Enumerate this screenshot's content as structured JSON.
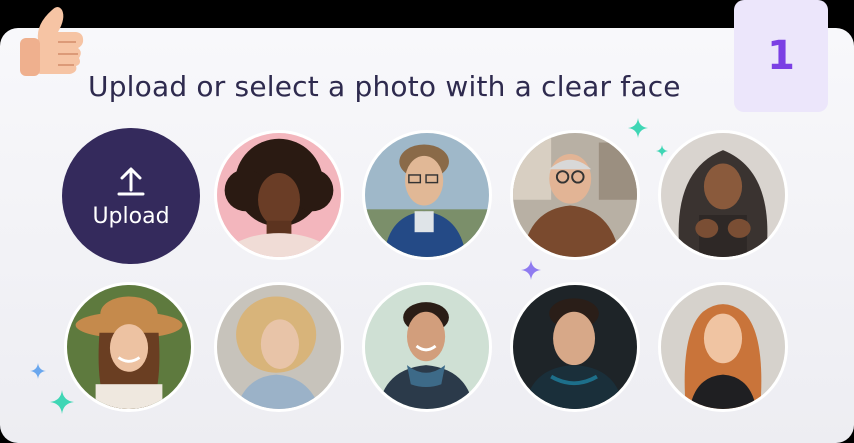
{
  "header": {
    "title": "Upload or select a photo with a clear face",
    "step_number": "1"
  },
  "upload": {
    "label": "Upload",
    "icon": "upload-icon"
  },
  "samples": [
    {
      "name": "sample-photo-1",
      "icon": "curly-hair-woman-portrait"
    },
    {
      "name": "sample-photo-2",
      "icon": "young-man-glasses-portrait"
    },
    {
      "name": "sample-photo-3",
      "icon": "elderly-man-glasses-portrait"
    },
    {
      "name": "sample-photo-4",
      "icon": "teen-hoodie-portrait"
    },
    {
      "name": "sample-photo-5",
      "icon": "woman-hat-portrait"
    },
    {
      "name": "sample-photo-6",
      "icon": "blonde-woman-portrait"
    },
    {
      "name": "sample-photo-7",
      "icon": "smiling-man-scarf-portrait"
    },
    {
      "name": "sample-photo-8",
      "icon": "man-dark-hoodie-portrait"
    },
    {
      "name": "sample-photo-9",
      "icon": "redhead-woman-portrait"
    }
  ],
  "colors": {
    "accent": "#7b3fe4",
    "upload_bg": "#342a5c",
    "title": "#2e2a4e",
    "sparkle_teal": "#3fd6b5",
    "sparkle_violet": "#8f7bf0"
  }
}
